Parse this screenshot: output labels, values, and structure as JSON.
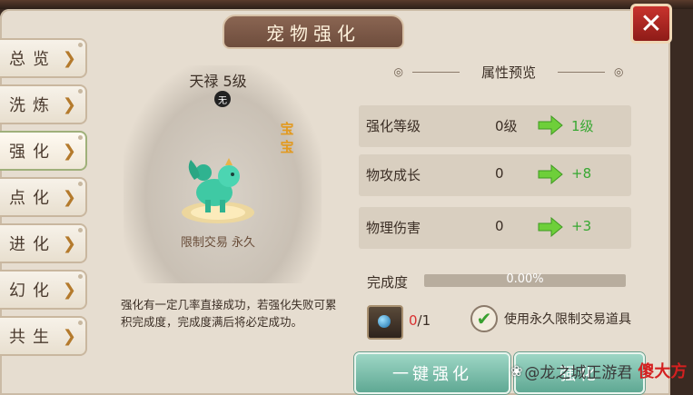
{
  "window": {
    "title": "宠物强化",
    "close_glyph": "✕"
  },
  "tabs": [
    {
      "label": "总览",
      "arrow": "❯",
      "active": false
    },
    {
      "label": "洗炼",
      "arrow": "❯",
      "active": false
    },
    {
      "label": "强化",
      "arrow": "❯",
      "active": true
    },
    {
      "label": "点化",
      "arrow": "❯",
      "active": false
    },
    {
      "label": "进化",
      "arrow": "❯",
      "active": false
    },
    {
      "label": "幻化",
      "arrow": "❯",
      "active": false
    },
    {
      "label": "共生",
      "arrow": "❯",
      "active": false
    }
  ],
  "pet": {
    "name": "天禄 5级",
    "badge": "无",
    "tag": "宝宝",
    "trade_note": "限制交易 永久"
  },
  "description": "强化有一定几率直接成功，若强化失败可累积完成度，完成度满后将必定成功。",
  "attributes": {
    "header": "属性预览",
    "rows": [
      {
        "name": "强化等级",
        "old": "0级",
        "new": "1级"
      },
      {
        "name": "物攻成长",
        "old": "0",
        "new": "+8"
      },
      {
        "name": "物理伤害",
        "old": "0",
        "new": "+3"
      }
    ]
  },
  "progress": {
    "label": "完成度",
    "value_text": "0.00%",
    "fraction": 0.0
  },
  "item": {
    "have": "0",
    "sep_need": "/1"
  },
  "option": {
    "check": "✔",
    "label": "使用永久限制交易道具"
  },
  "buttons": {
    "one_key": "一键强化",
    "enhance": "强化"
  },
  "watermark": {
    "prefix": "@龙之城正游君",
    "brand": "傻大方"
  },
  "colors": {
    "accent_green": "#38a832",
    "button_teal": "#5fa893",
    "count_red": "#d83030",
    "close_red": "#c8332d"
  }
}
